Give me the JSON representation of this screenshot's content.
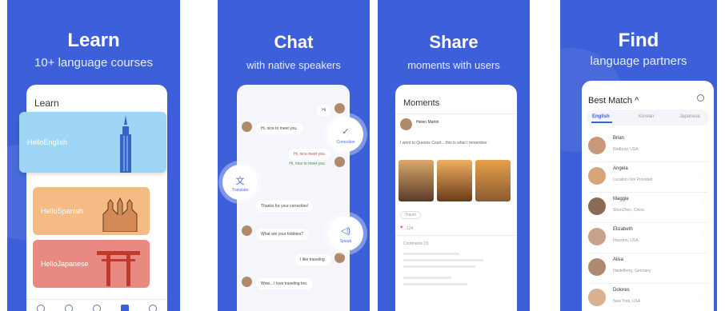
{
  "panels": [
    {
      "title": "Learn",
      "subtitle": "10+ language courses"
    },
    {
      "title": "Chat",
      "subtitle": "with native speakers"
    },
    {
      "title": "Share",
      "subtitle": "moments with users"
    },
    {
      "title": "Find",
      "subtitle": "language partners"
    }
  ],
  "learn": {
    "header": "Learn",
    "courses": [
      {
        "label": "HelloEnglish",
        "color": "#9fd6f6"
      },
      {
        "label": "HelloSpanish",
        "color": "#f4bb84"
      },
      {
        "label": "HelloJapanese",
        "color": "#e98a82"
      }
    ]
  },
  "chat": {
    "messages": [
      "Hi",
      "Hi, nice to meet you.",
      "Hi, nice meet you.",
      "Hi, nice to meet you.",
      "Thanks for your correction!",
      "What are your hobbies?",
      "I like traveling.",
      "Wow... I love traveling too."
    ],
    "actions": [
      {
        "icon": "✓",
        "label": "Correction"
      },
      {
        "icon": "文",
        "label": "Translate"
      },
      {
        "icon": "◁)",
        "label": "Speak"
      }
    ]
  },
  "moments": {
    "header": "Moments",
    "user": "Helen Martin",
    "text": "I went to Queens Court... this is what I remember",
    "tag": "Travel",
    "likes": "124",
    "comments_label": "Comments (3)"
  },
  "find": {
    "header": "Best Match",
    "chevron": "^",
    "search_icon": "search-icon",
    "tabs": [
      "English",
      "Korean",
      "Japanese"
    ],
    "active_tab": "English",
    "people": [
      {
        "name": "Brian",
        "loc": "Redbury, USA",
        "color": "#c99a7a"
      },
      {
        "name": "Angela",
        "loc": "Location Not Provided",
        "color": "#d7a47c"
      },
      {
        "name": "Maggie",
        "loc": "ShenZhen, China",
        "color": "#8a6a55"
      },
      {
        "name": "Elizabeth",
        "loc": "Houston, USA",
        "color": "#c9a18a"
      },
      {
        "name": "Alisa",
        "loc": "Heidelberg, Germany",
        "color": "#b08a70"
      },
      {
        "name": "Dolores",
        "loc": "New York, USA",
        "color": "#d9b090"
      }
    ]
  }
}
